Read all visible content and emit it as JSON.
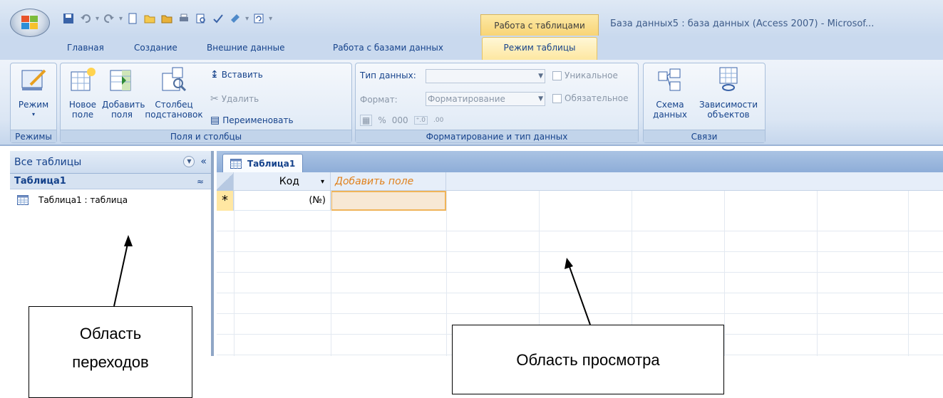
{
  "window": {
    "context_tab": "Работа с таблицами",
    "title": "База данных5 : база данных (Access 2007) - Microsof..."
  },
  "ribbon_tabs": [
    {
      "label": "Главная"
    },
    {
      "label": "Создание"
    },
    {
      "label": "Внешние данные"
    },
    {
      "label": "Работа с базами данных"
    },
    {
      "label": "Режим таблицы"
    }
  ],
  "groups": {
    "views": {
      "label": "Режимы",
      "mode_label": "Режим"
    },
    "fields": {
      "label": "Поля и столбцы",
      "new_field_1": "Новое",
      "new_field_2": "поле",
      "add_fields_1": "Добавить",
      "add_fields_2": "поля",
      "lookup_1": "Столбец",
      "lookup_2": "подстановок",
      "insert": "Вставить",
      "delete": "Удалить",
      "rename": "Переименовать"
    },
    "formatting": {
      "label": "Форматирование и тип данных",
      "data_type_label": "Тип данных:",
      "format_label": "Формат:",
      "format_value": "Форматирование",
      "unique": "Уникальное",
      "required": "Обязательное",
      "percent": "%",
      "thousands": "000"
    },
    "relationships": {
      "label": "Связи",
      "schema_1": "Схема",
      "schema_2": "данных",
      "deps_1": "Зависимости",
      "deps_2": "объектов"
    }
  },
  "nav": {
    "header": "Все таблицы",
    "group": "Таблица1",
    "item": "Таблица1 : таблица"
  },
  "document": {
    "tab": "Таблица1",
    "col_id": "Код",
    "col_add": "Добавить поле",
    "new_row_marker": "*",
    "new_row_value": "(№)"
  },
  "callouts": {
    "nav_line1": "Область",
    "nav_line2": "переходов",
    "view": "Область просмотра"
  }
}
